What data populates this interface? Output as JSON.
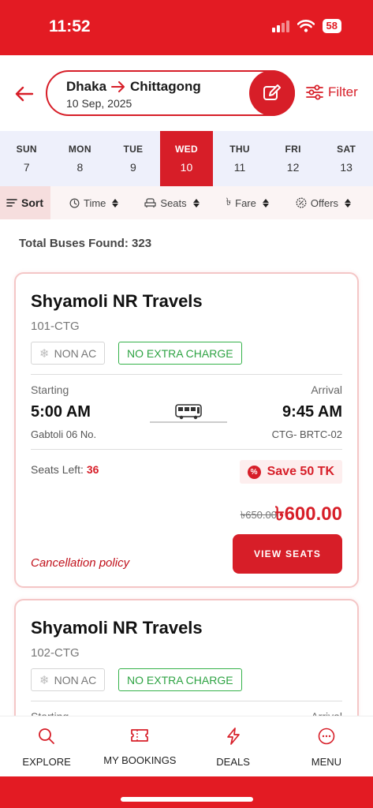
{
  "status_bar": {
    "time": "11:52",
    "battery": "58"
  },
  "header": {
    "from": "Dhaka",
    "to": "Chittagong",
    "date": "10 Sep, 2025",
    "filter_label": "Filter"
  },
  "days": [
    {
      "name": "SUN",
      "date": "7",
      "active": false
    },
    {
      "name": "MON",
      "date": "8",
      "active": false
    },
    {
      "name": "TUE",
      "date": "9",
      "active": false
    },
    {
      "name": "WED",
      "date": "10",
      "active": true
    },
    {
      "name": "THU",
      "date": "11",
      "active": false
    },
    {
      "name": "FRI",
      "date": "12",
      "active": false
    },
    {
      "name": "SAT",
      "date": "13",
      "active": false
    }
  ],
  "sort_bar": {
    "sort": "Sort",
    "time": "Time",
    "seats": "Seats",
    "fare": "Fare",
    "offers": "Offers"
  },
  "total_found": "Total Buses Found: 323",
  "buses": [
    {
      "operator": "Shyamoli NR Travels",
      "code": "101-CTG",
      "ac_tag": "NON AC",
      "charge_tag": "NO EXTRA CHARGE",
      "starting_label": "Starting",
      "arrival_label": "Arrival",
      "dep_time": "5:00 AM",
      "arr_time": "9:45 AM",
      "dep_place": "Gabtoli 06 No.",
      "arr_place": "CTG- BRTC-02",
      "seats_label": "Seats Left:",
      "seats_left": "36",
      "save": "Save 50 TK",
      "old_price": "৳650.00",
      "new_price": "৳600.00",
      "cancel_label": "Cancellation policy",
      "view_label": "VIEW SEATS"
    },
    {
      "operator": "Shyamoli NR Travels",
      "code": "102-CTG",
      "ac_tag": "NON AC",
      "charge_tag": "NO EXTRA CHARGE",
      "starting_label": "Starting",
      "arrival_label": "Arrival"
    }
  ],
  "bottom_nav": [
    {
      "label": "EXPLORE",
      "icon": "search-icon"
    },
    {
      "label": "MY BOOKINGS",
      "icon": "ticket-icon"
    },
    {
      "label": "DEALS",
      "icon": "lightning-icon"
    },
    {
      "label": "MENU",
      "icon": "menu-dots-icon"
    }
  ],
  "colors": {
    "brand": "#e31b23",
    "accent_green": "#2ea343"
  }
}
